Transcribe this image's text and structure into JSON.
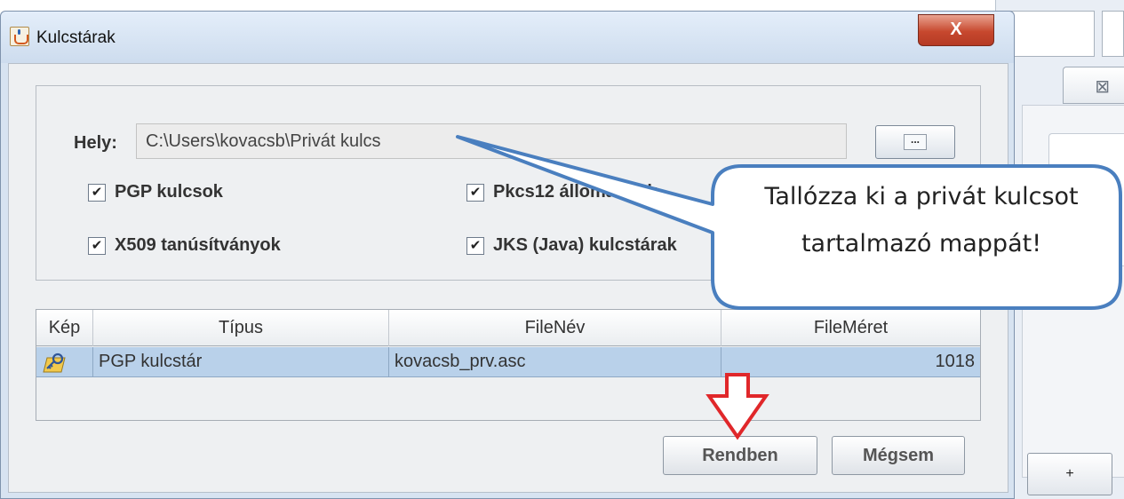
{
  "window": {
    "title": "Kulcstárak",
    "close_label": "X"
  },
  "location": {
    "label": "Hely:",
    "value": "C:\\Users\\kovacsb\\Privát kulcs",
    "browse_label": "..."
  },
  "checkboxes": [
    {
      "label": "PGP kulcsok",
      "checked": true
    },
    {
      "label": "Pkcs12 állományok",
      "checked": true
    },
    {
      "label": "X509 tanúsítványok",
      "checked": true
    },
    {
      "label": "JKS (Java) kulcstárak",
      "checked": true
    }
  ],
  "table": {
    "headers": [
      "Kép",
      "Típus",
      "FileNév",
      "FileMéret"
    ],
    "rows": [
      {
        "icon": "key-folder-icon",
        "type": "PGP kulcstár",
        "file_name": "kovacsb_prv.asc",
        "file_size": "1018"
      }
    ]
  },
  "buttons": {
    "ok": "Rendben",
    "cancel": "Mégsem"
  },
  "callout": {
    "line1": "Tallózza ki a privát kulcsot",
    "line2": "tartalmazó mappát!"
  },
  "background_app": {
    "tab_close": "⊠",
    "plus_label": "+"
  },
  "colors": {
    "callout_border": "#4a7fbf",
    "arrow": "#e0272a",
    "selected_row": "#b9d1ea"
  }
}
